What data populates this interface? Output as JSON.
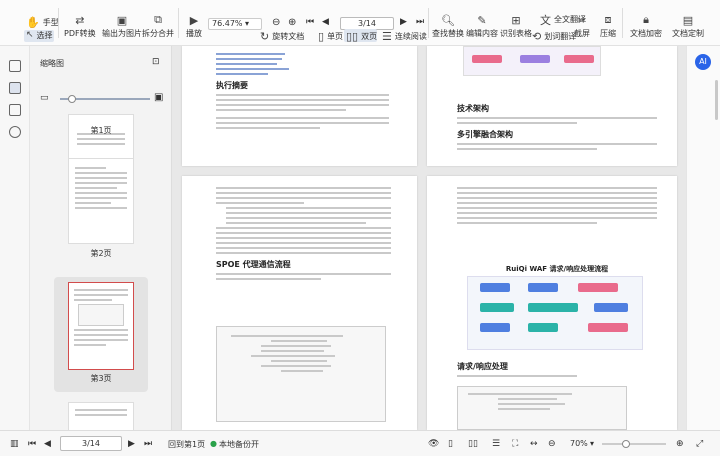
{
  "toolbar": {
    "hand": "手型",
    "select": "选择",
    "pdf_convert": "PDF转换",
    "export_image": "输出为图片",
    "split_merge": "拆分合并",
    "play": "播放",
    "zoom": "76.47%",
    "page_input": "3/14",
    "rotate": "旋转文档",
    "single": "单页",
    "double": "双页",
    "continuous": "连续阅读",
    "find_replace": "查找替换",
    "edit_content": "编辑内容",
    "ocr": "识别表格",
    "full_translate": "全文翻译",
    "word_translate": "划词翻译",
    "screenshot": "截屏",
    "compress": "压缩",
    "encrypt": "文档加密",
    "custom": "文档定制"
  },
  "sidebar": {
    "title": "缩略图",
    "pages": [
      "第1页",
      "第2页",
      "第3页"
    ]
  },
  "doc": {
    "p1_heading": "执行摘要",
    "p1_right_heading": "技术架构",
    "p1_right_sub": "多引擎融合架构",
    "p2_right_title": "RuiQi WAF 请求/响应处理流程",
    "p2_right_sub": "请求/响应处理",
    "p2_left_sub": "SPOE 代理通信流程"
  },
  "status": {
    "page": "3/14",
    "back": "回到第1页",
    "backup": "本地备份开",
    "zoom": "70%"
  },
  "colors": {
    "accent": "#2a64e8",
    "flow_blue": "#4f7fe0",
    "flow_teal": "#2bb3a8",
    "flow_pink": "#e96b8c"
  }
}
